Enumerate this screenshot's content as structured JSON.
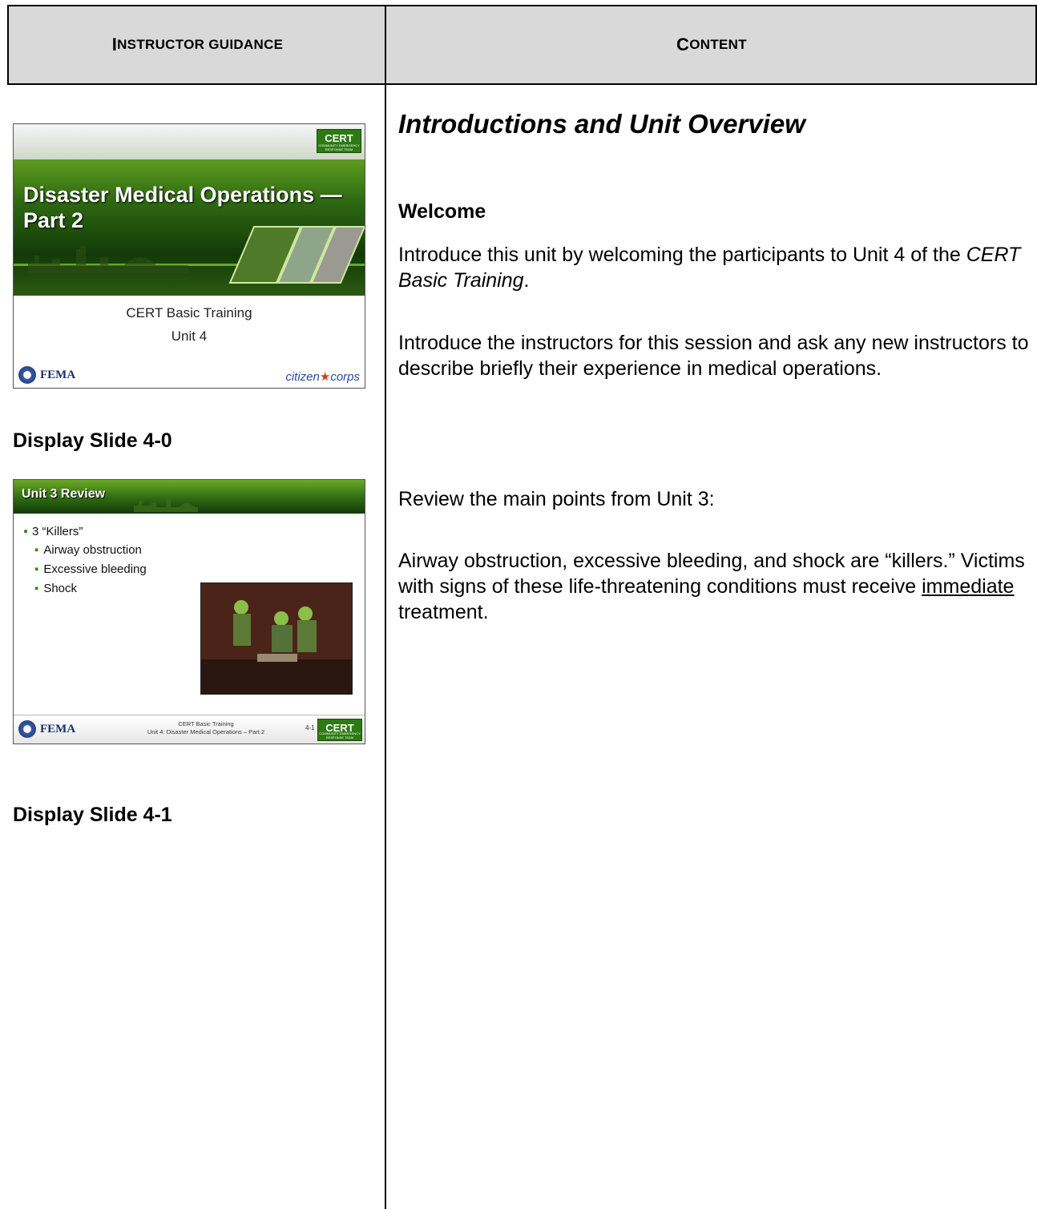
{
  "header": {
    "left_first": "I",
    "left_rest": "NSTRUCTOR GUIDANCE",
    "right_first": "C",
    "right_rest": "ONTENT"
  },
  "slide0": {
    "logo": "CERT",
    "logo_sub": "COMMUNITY EMERGENCY RESPONSE TEAM",
    "title": "Disaster Medical Operations — Part 2",
    "subtitle1": "CERT Basic Training",
    "subtitle2": "Unit 4",
    "fema": "FEMA",
    "citizen_a": "citizen",
    "citizen_b": "corps"
  },
  "caption0": "Display Slide 4-0",
  "slide1": {
    "title": "Unit 3 Review",
    "bullet": "3 “Killers”",
    "subbullets": [
      "Airway obstruction",
      "Excessive bleeding",
      "Shock"
    ],
    "fema": "FEMA",
    "footer1": "CERT Basic Training",
    "footer2": "Unit 4: Disaster Medical Operations – Part 2",
    "number": "4-1",
    "logo": "CERT",
    "logo_sub": "COMMUNITY EMERGENCY RESPONSE TEAM"
  },
  "caption1": "Display Slide 4-1",
  "content": {
    "title": "Introductions and Unit Overview",
    "welcome": "Welcome",
    "p1_a": "Introduce this unit by welcoming the participants to Unit 4 of the ",
    "p1_b": "CERT Basic Training",
    "p1_c": ".",
    "p2": "Introduce the instructors for this session and ask any new instructors to describe briefly their experience in medical operations.",
    "p3": "Review the main points from Unit 3:",
    "p4_a": "Airway obstruction, excessive bleeding, and shock are “killers.”  Victims with signs of these life-threatening conditions must receive ",
    "p4_b": "immediate",
    "p4_c": " treatment."
  }
}
